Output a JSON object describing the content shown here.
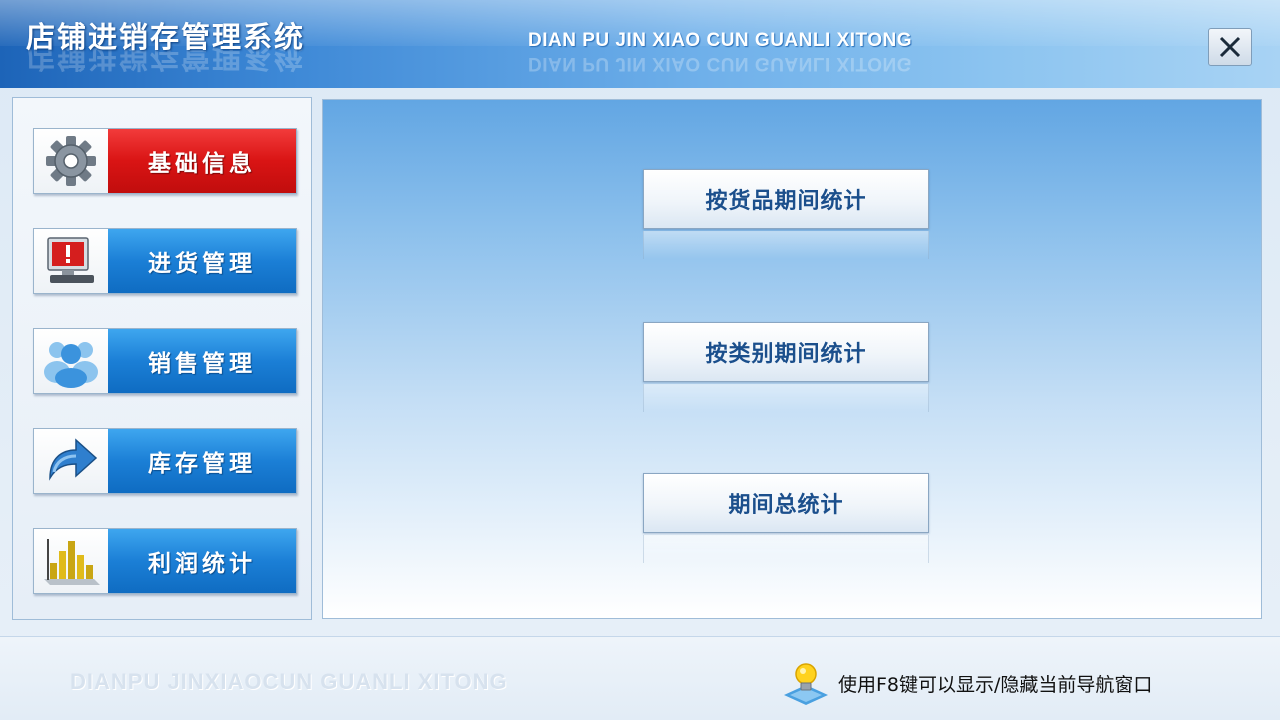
{
  "window": {
    "title": "店铺进销存管理系统",
    "subtitle": "DIAN PU JIN XIAO CUN GUANLI XITONG"
  },
  "nav": {
    "items": [
      {
        "label": "基础信息",
        "icon": "gear-icon",
        "active": true
      },
      {
        "label": "进货管理",
        "icon": "warning-monitor-icon",
        "active": false
      },
      {
        "label": "销售管理",
        "icon": "users-icon",
        "active": false
      },
      {
        "label": "库存管理",
        "icon": "arrow-icon",
        "active": false
      },
      {
        "label": "利润统计",
        "icon": "bar-chart-icon",
        "active": false
      }
    ]
  },
  "main": {
    "buttons": [
      {
        "label": "按货品期间统计"
      },
      {
        "label": "按类别期间统计"
      },
      {
        "label": "期间总统计"
      }
    ]
  },
  "footer": {
    "brand": "DIANPU JINXIAOCUN GUANLI XITONG",
    "hint": "使用F8键可以显示/隐藏当前导航窗口",
    "hint_icon": "lightbulb-icon"
  },
  "colors": {
    "active_nav": "#d91414",
    "nav": "#1b7fd6",
    "title_bar": "#3d88d6",
    "button_text": "#1b4f8c"
  }
}
